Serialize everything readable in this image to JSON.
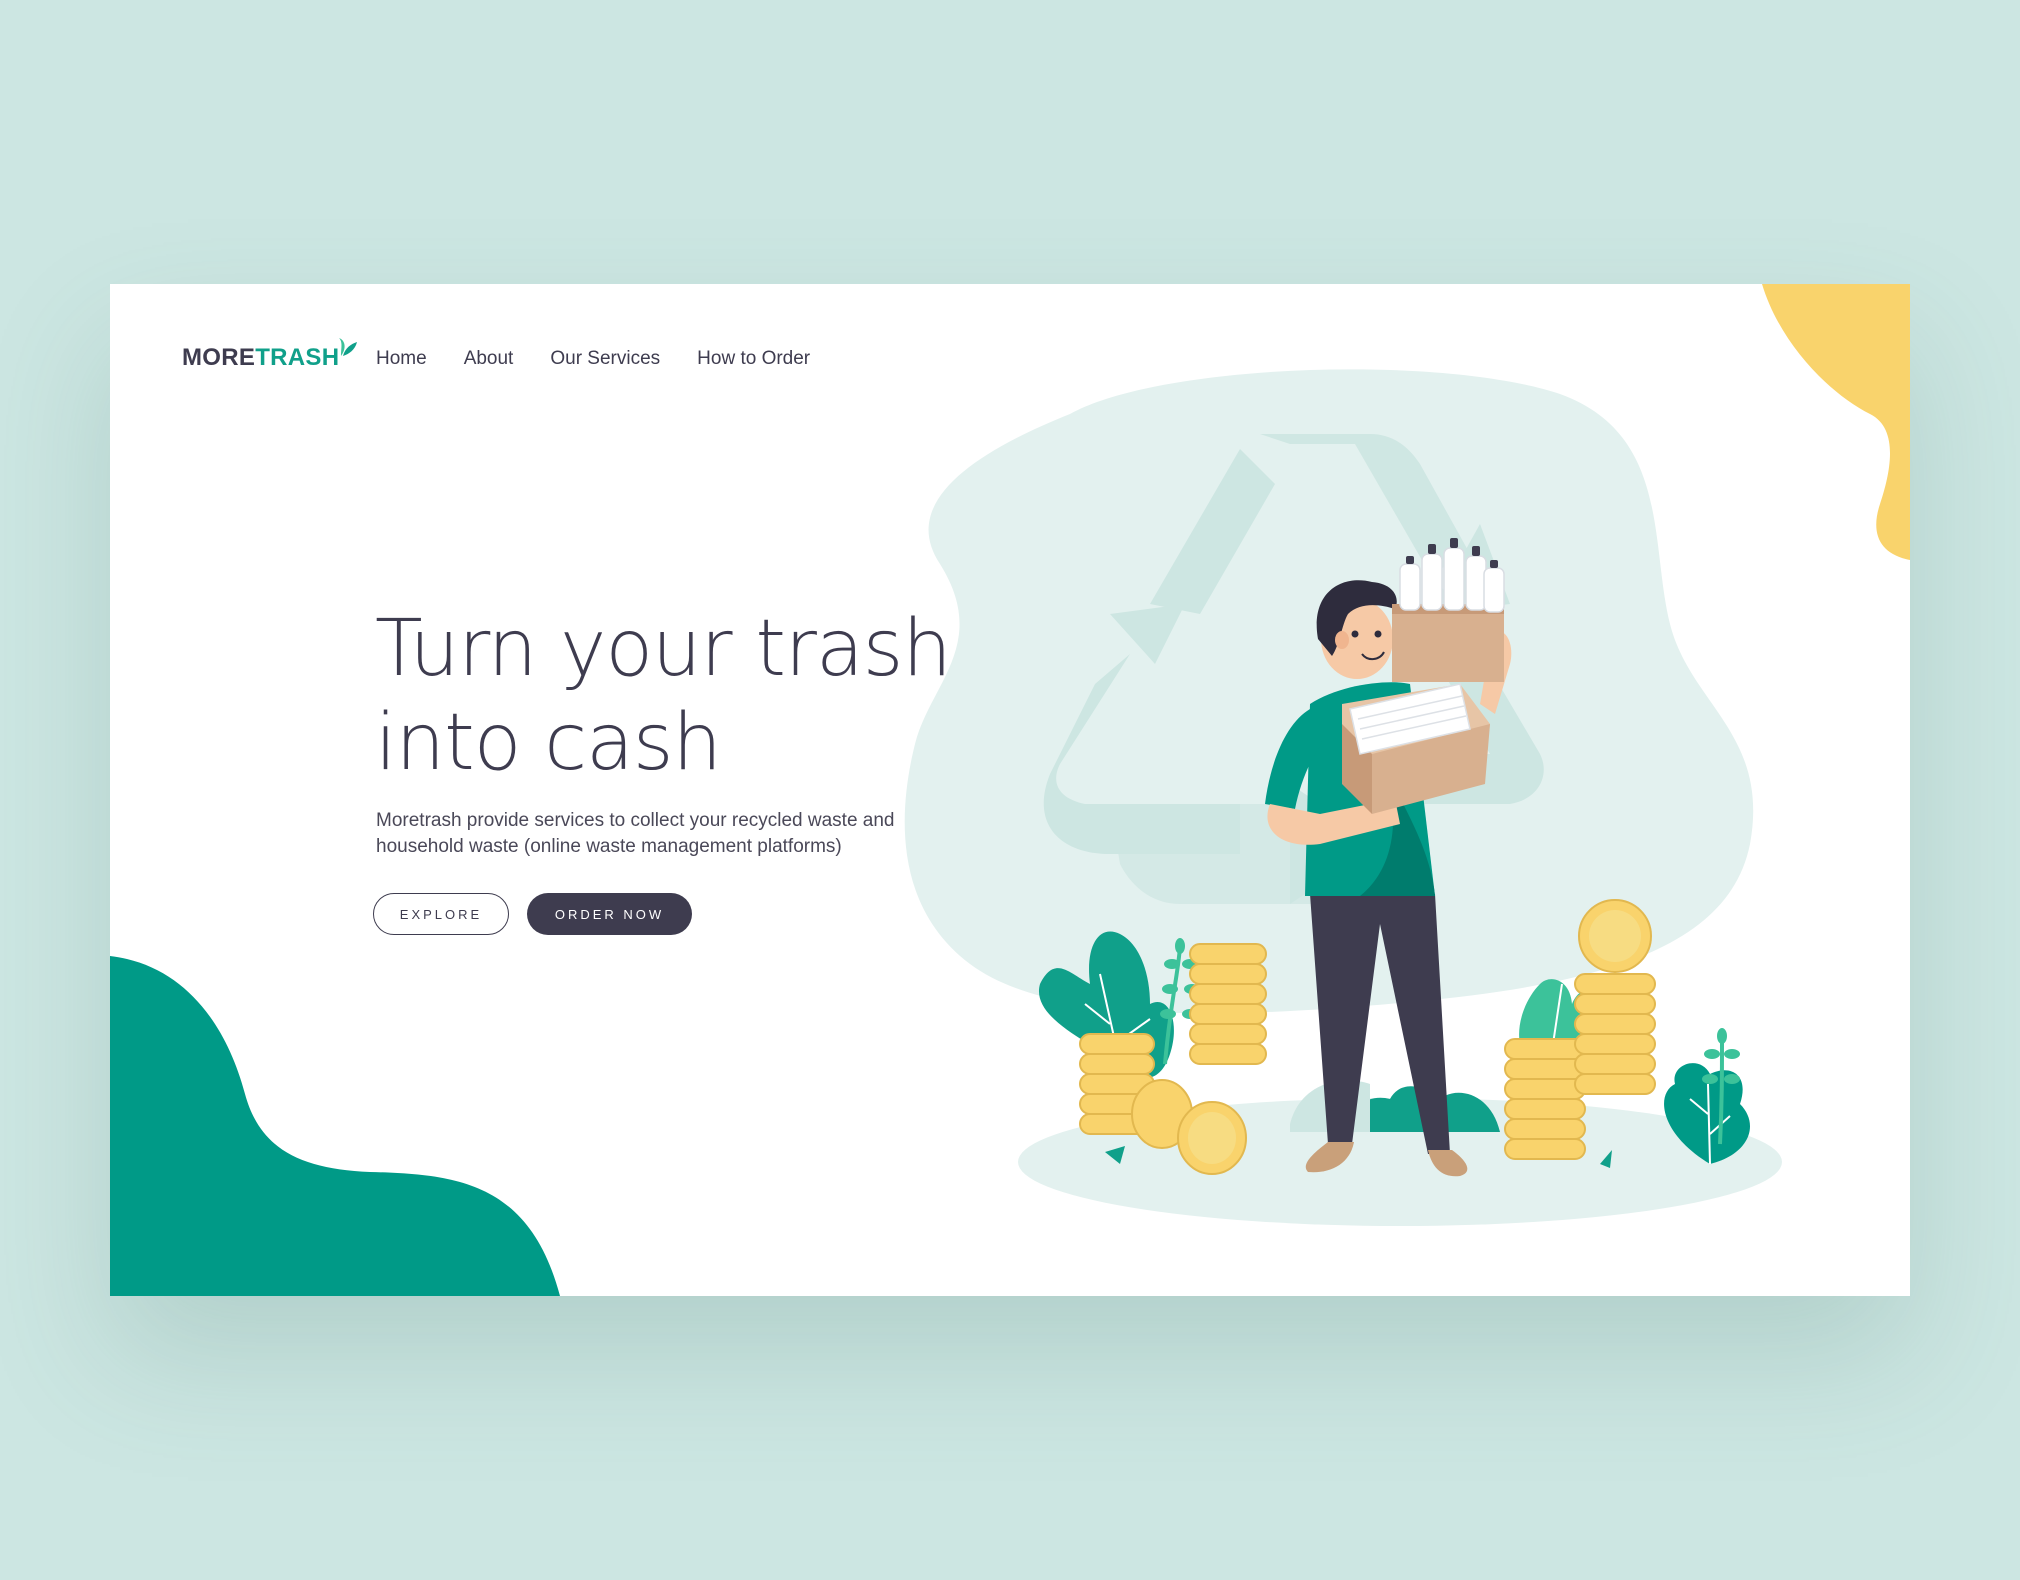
{
  "brand": {
    "name_part1": "MORE",
    "name_part2": "TRASH",
    "dark_color": "#3e3c4f",
    "accent_color": "#10a08a",
    "teal_blob_color": "#009a87",
    "yellow_color": "#f9d36c",
    "background_color": "#cce6e2"
  },
  "nav": {
    "items": [
      {
        "label": "Home"
      },
      {
        "label": "About"
      },
      {
        "label": "Our Services"
      },
      {
        "label": "How to Order"
      }
    ]
  },
  "hero": {
    "title_line1": "Turn your trash",
    "title_line2": "into cash",
    "description": "Moretrash provide services to collect your recycled waste and household waste (online waste management platforms)",
    "explore_label": "EXPLORE",
    "order_label": "ORDER NOW"
  },
  "illustration": {
    "icons": [
      "recycle-icon",
      "person",
      "box-with-bottles",
      "coin-stacks",
      "plants"
    ]
  }
}
